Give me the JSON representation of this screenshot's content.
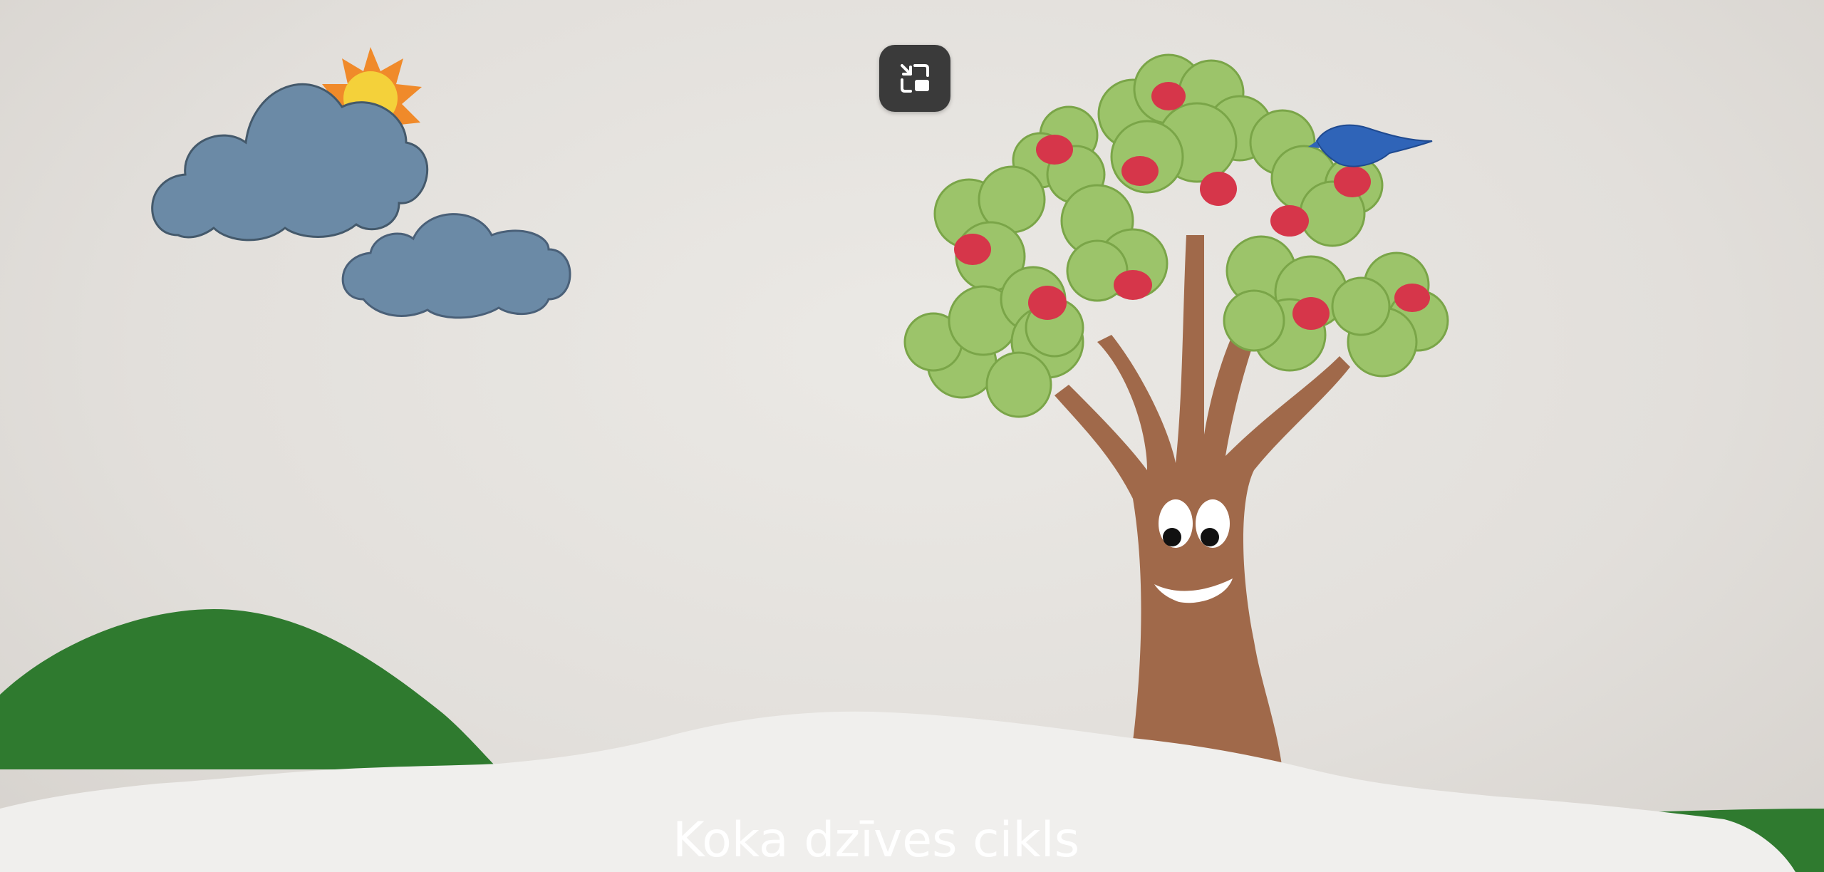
{
  "video": {
    "caption": "Koka dzīves cikls"
  },
  "controls": {
    "exit_pip_icon": "exit-picture-in-picture-icon"
  },
  "colors": {
    "background": "#e6e3df",
    "cloud": "#6b8aa6",
    "sun": "#f2a33a",
    "sun_core": "#f4d13a",
    "tree_trunk": "#a0694a",
    "leaves": "#9cc46a",
    "apple": "#d6364a",
    "bird": "#2f64b8",
    "hill": "#2f7a2f",
    "snow": "#f0efed",
    "button": "#3a3a3a"
  }
}
